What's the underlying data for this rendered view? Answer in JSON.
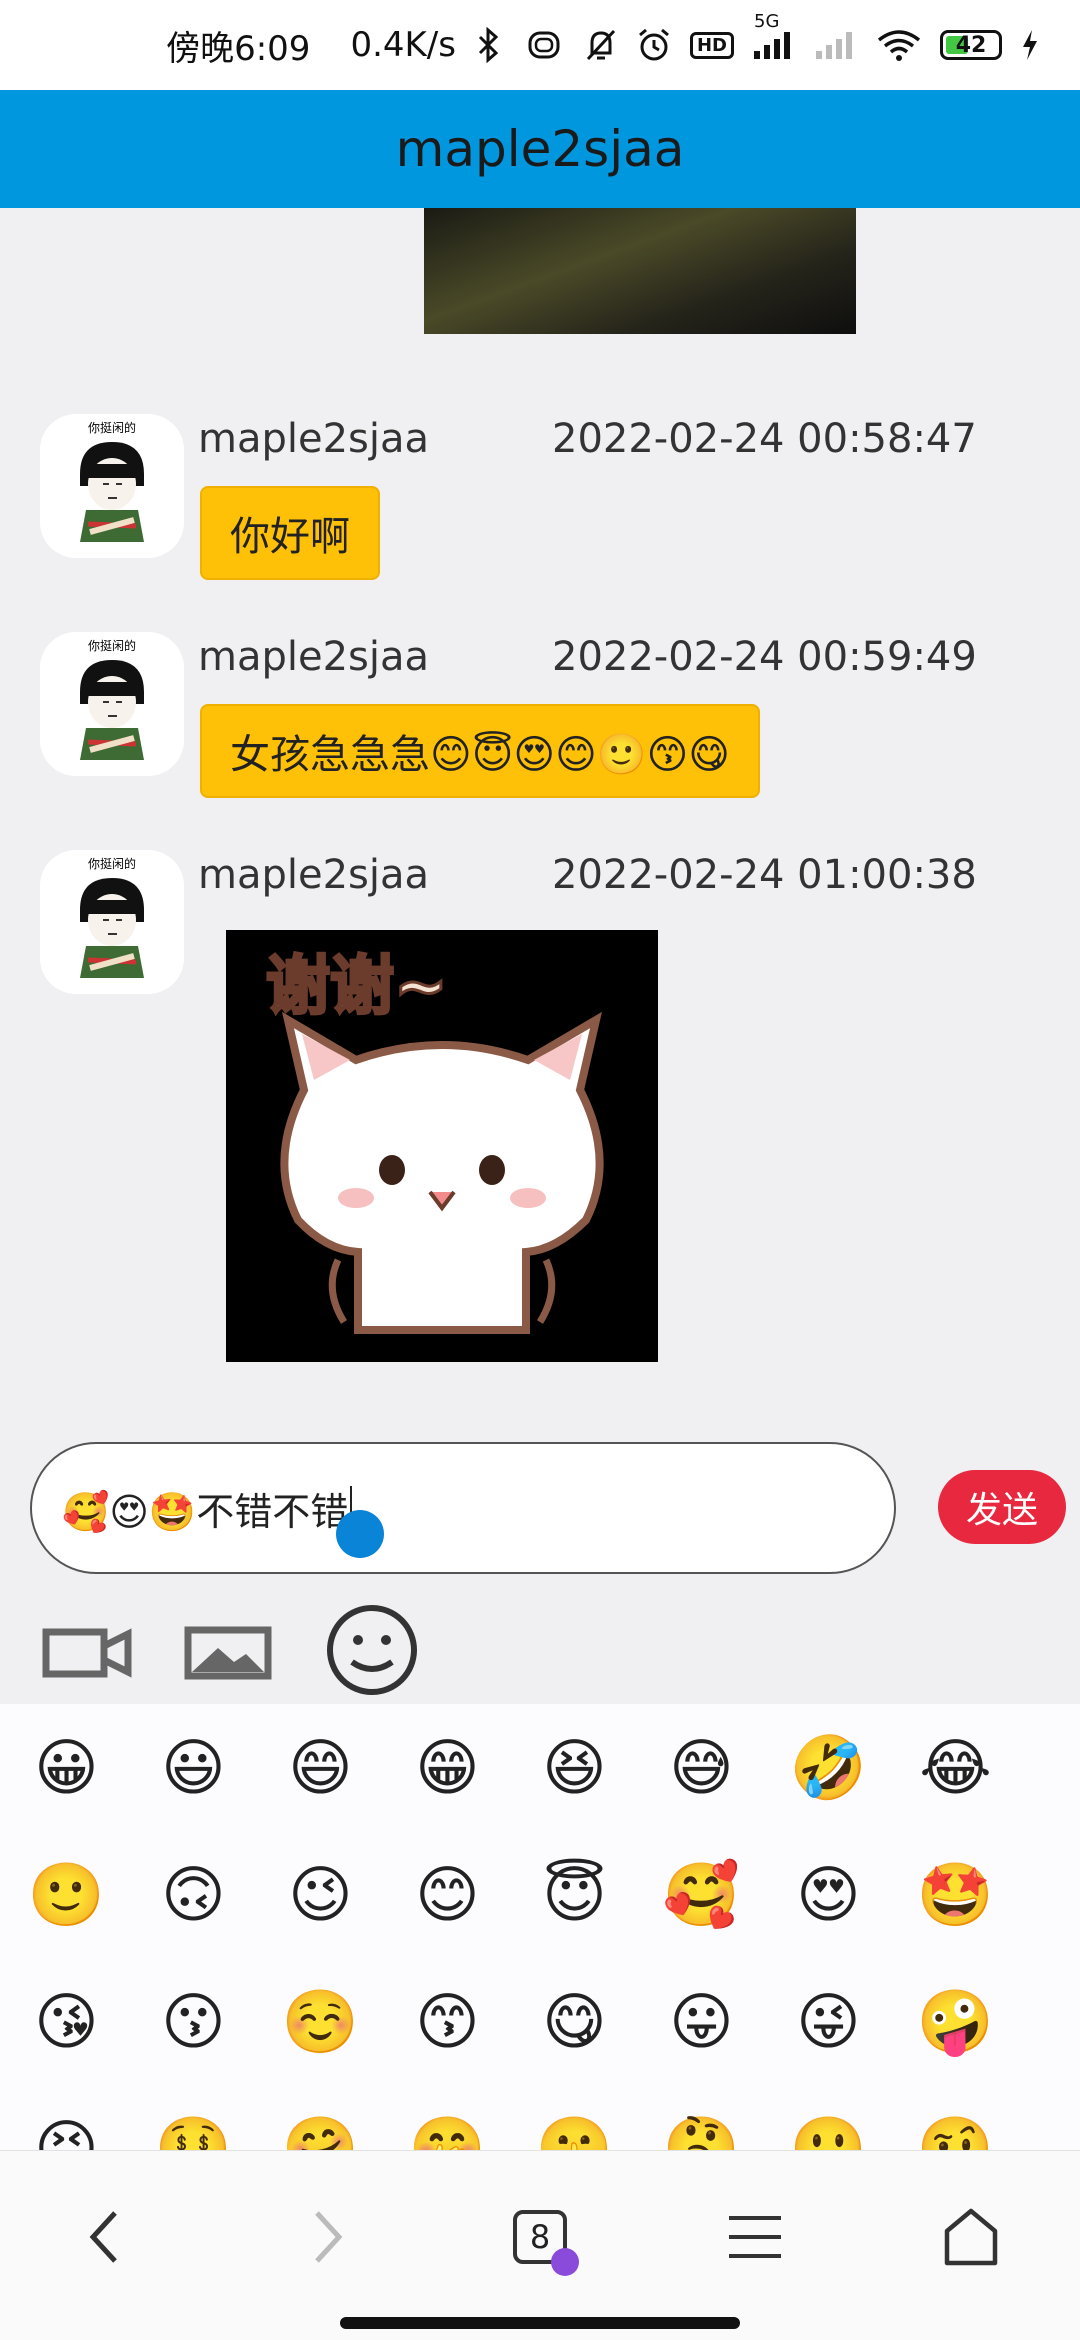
{
  "status_bar": {
    "time": "傍晚6:09",
    "network_speed": "0.4K/s",
    "hd_label": "HD",
    "signal_label": "5G",
    "battery_level": "42",
    "icons": [
      "bluetooth-icon",
      "vibrate-icon",
      "mute-bell-icon",
      "alarm-icon",
      "hd-icon",
      "signal-5g-icon",
      "signal-icon",
      "wifi-icon",
      "battery-icon",
      "charging-icon"
    ]
  },
  "header": {
    "title": "maple2sjaa",
    "background": "#0097de"
  },
  "messages": [
    {
      "sender": "maple2sjaa",
      "timestamp": "2022-02-24 00:58:47",
      "text": "你好啊",
      "avatar_text": "你挺闲的"
    },
    {
      "sender": "maple2sjaa",
      "timestamp": "2022-02-24 00:59:49",
      "text": "女孩急急急😊😇😍😊🙂😙😋",
      "avatar_text": "你挺闲的"
    },
    {
      "sender": "maple2sjaa",
      "timestamp": "2022-02-24 01:00:38",
      "sticker_text": "谢谢~",
      "avatar_text": "你挺闲的"
    }
  ],
  "input": {
    "value": "🥰😍🤩不错不错",
    "send_label": "发送",
    "tools": [
      "video-camera-icon",
      "image-icon",
      "emoji-icon"
    ]
  },
  "emoji_panel": {
    "rows": [
      [
        "😀",
        "😃",
        "😄",
        "😁",
        "😆",
        "😅",
        "🤣",
        "😂"
      ],
      [
        "🙂",
        "🙃",
        "😉",
        "😊",
        "😇",
        "🥰",
        "😍",
        "🤩"
      ],
      [
        "😘",
        "😗",
        "☺️",
        "😙",
        "😋",
        "😛",
        "😜",
        "🤪"
      ],
      [
        "😝",
        "🤑",
        "🤗",
        "🤭",
        "🤫",
        "🤔",
        "🤐",
        "🤨"
      ]
    ]
  },
  "browser_nav": {
    "tab_count": "8",
    "buttons": [
      "back-icon",
      "forward-icon",
      "tabs-icon",
      "menu-icon",
      "home-icon"
    ]
  },
  "colors": {
    "bubble": "#ffc107",
    "send_button": "#e8283e",
    "header": "#0097de",
    "cursor": "#0a84d6"
  }
}
